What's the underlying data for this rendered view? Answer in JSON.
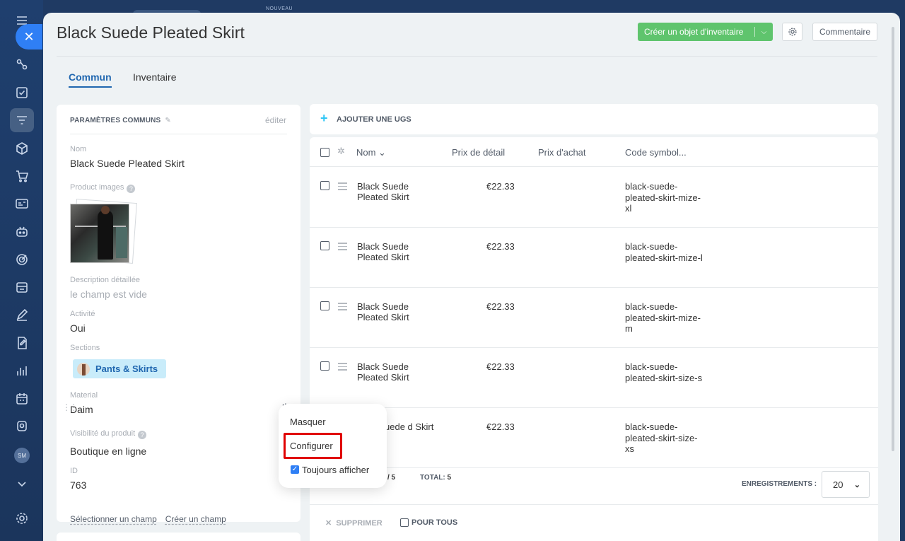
{
  "nav": {
    "close_symbol": "✕",
    "avatar_initials": "SM",
    "new_badge": "NOUVEAU"
  },
  "header": {
    "title": "Black Suede Pleated Skirt",
    "create_button": "Créer un objet d'inventaire",
    "comment_button": "Commentaire"
  },
  "tabs": [
    "Commun",
    "Inventaire"
  ],
  "left_card": {
    "heading": "PARAMÈTRES COMMUNS",
    "edit_link": "éditer",
    "name_label": "Nom",
    "name_value": "Black Suede Pleated Skirt",
    "images_label": "Product images",
    "description_label": "Description détaillée",
    "description_value": "le champ est vide",
    "activity_label": "Activité",
    "activity_value": "Oui",
    "sections_label": "Sections",
    "section_tag": "Pants & Skirts",
    "material_label": "Material",
    "material_value": "Daim",
    "visibility_label": "Visibilité du produit",
    "visibility_value": "Boutique en ligne",
    "id_label": "ID",
    "id_value": "763",
    "select_field_link": "Sélectionner un champ",
    "create_field_link": "Créer un champ"
  },
  "sku": {
    "add_label": "AJOUTER UNE UGS",
    "columns": {
      "name": "Nom ⌄",
      "retail_price": "Prix de détail",
      "purchase_price": "Prix d'achat",
      "symbolic_code": "Code symbol..."
    },
    "rows": [
      {
        "name": "Black Suede Pleated Skirt",
        "price": "€22.33",
        "code": "black-suede-pleated-skirt-mize-xl"
      },
      {
        "name": "Black Suede Pleated Skirt",
        "price": "€22.33",
        "code": "black-suede-pleated-skirt-mize-l"
      },
      {
        "name": "Black Suede Pleated Skirt",
        "price": "€22.33",
        "code": "black-suede-pleated-skirt-mize-m"
      },
      {
        "name": "Black Suede Pleated Skirt",
        "price": "€22.33",
        "code": "black-suede-pleated-skirt-size-s"
      },
      {
        "name": "uede d Skirt",
        "price": "€22.33",
        "code": "black-suede-pleated-skirt-size-xs"
      }
    ],
    "footer": {
      "page": "/ 5",
      "total_label": "TOTAL:",
      "total_value": "5",
      "records_label": "ENREGISTREMENTS :",
      "records_value": "20"
    },
    "actions": {
      "delete": "SUPPRIMER",
      "for_all": "POUR TOUS"
    }
  },
  "popup": {
    "hide": "Masquer",
    "configure": "Configurer",
    "always_show": "Toujours afficher"
  },
  "colors": {
    "accent": "#2067b0",
    "create_button": "#5fc46d",
    "highlight": "#e00000"
  }
}
